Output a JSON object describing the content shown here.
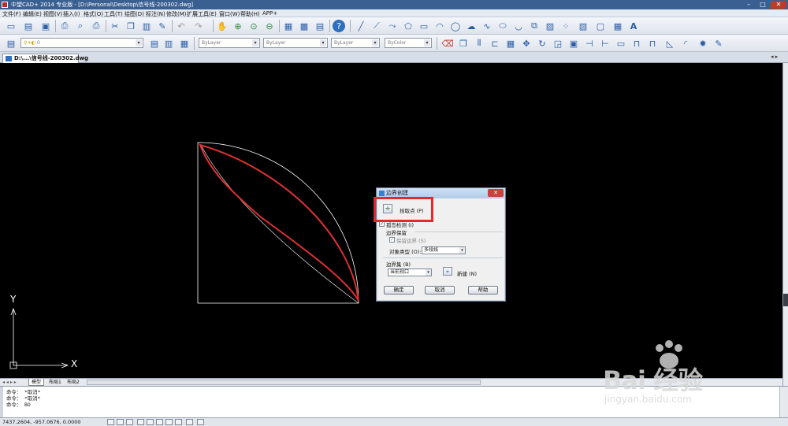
{
  "titlebar": {
    "title": "中望CAD+ 2014 专业版 - [D:\\Personal\\Desktop\\信号线-200302.dwg]",
    "min": "–",
    "max": "□",
    "close": "✕"
  },
  "menubar": {
    "items": [
      "文件(F)",
      "编辑(E)",
      "视图(V)",
      "插入(I)",
      "格式(O)",
      "工具(T)",
      "绘图(D)",
      "标注(N)",
      "修改(M)",
      "扩展工具(E)",
      "窗口(W)",
      "帮助(H)",
      "APP+"
    ]
  },
  "toolbar2": {
    "layer_combo": "0",
    "color_combo": "ByLayer",
    "linetype_combo": "ByLayer",
    "lineweight_combo": "ByLayer",
    "plotstyle_combo": "ByColor"
  },
  "doc_tab": {
    "label": "D:\\...\\信号线-200302.dwg",
    "nav": "◂ ▸"
  },
  "canvas": {
    "ucs_x": "X",
    "ucs_y": "Y"
  },
  "layout_tabs": [
    "模型",
    "布局1",
    "布局2"
  ],
  "command": {
    "lines": [
      "命令： *取消*",
      "命令： *取消*",
      "命令： BO"
    ]
  },
  "status": {
    "coords": "7437.2604,  -957.0676,  0.0000"
  },
  "dialog": {
    "title": "边界创建",
    "close": "✕",
    "pick_points": "拾取点 (P)",
    "island_detect": "孤岛检测 (I)",
    "island_checked": true,
    "boundary_retain_group": "边界保留",
    "retain_boundary": "保留边界 (S)",
    "retain_checked": true,
    "object_type_label": "对象类型 (O):",
    "object_type_value": "多段线",
    "boundary_set_group": "边界集 (B)",
    "boundary_set_value": "当前视口",
    "new_button": "新建 (N)",
    "ok": "确定",
    "cancel": "取消",
    "help": "帮助"
  },
  "watermark": {
    "brand": "Bai 经验",
    "url": "jingyan.baidu.com"
  },
  "colors": {
    "titlebar": "#3a5f91",
    "canvas": "#000000",
    "highlight": "#e12a2a",
    "shape_white": "#ffffff",
    "shape_red": "#e03030"
  }
}
